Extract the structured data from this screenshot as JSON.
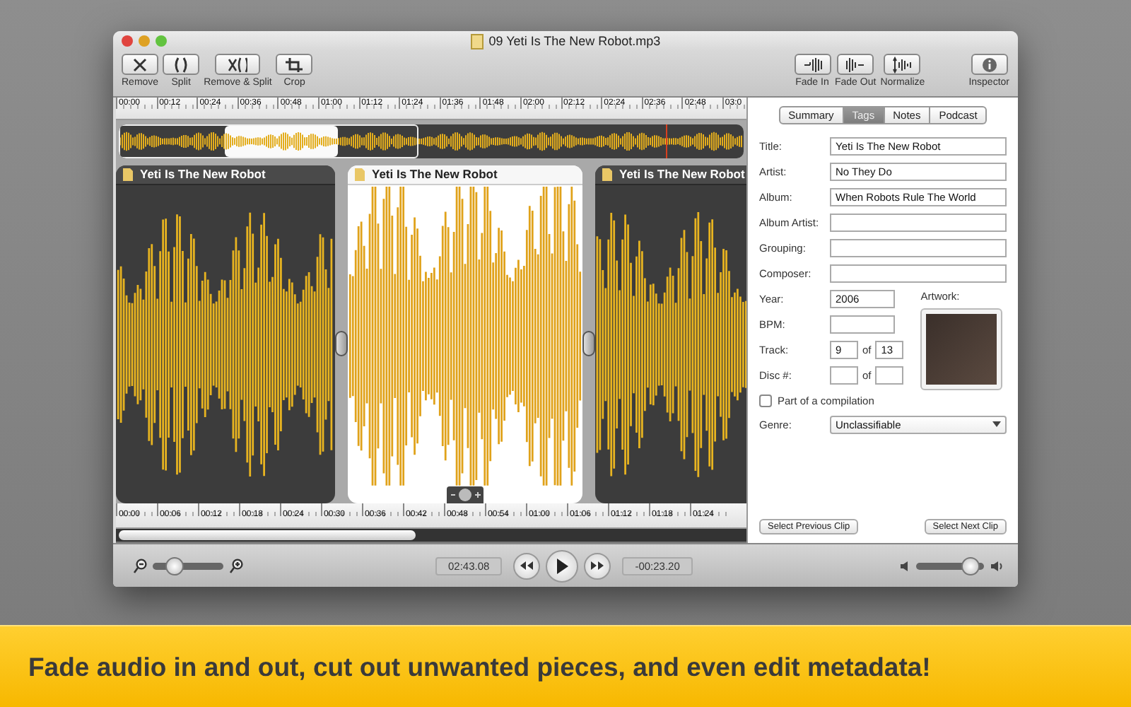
{
  "window": {
    "title": "09 Yeti Is The New Robot.mp3"
  },
  "toolbar": {
    "left": [
      {
        "label": "Remove"
      },
      {
        "label": "Split"
      },
      {
        "label": "Remove & Split"
      },
      {
        "label": "Crop"
      }
    ],
    "right": [
      {
        "label": "Fade In"
      },
      {
        "label": "Fade Out"
      },
      {
        "label": "Normalize"
      },
      {
        "label": "Inspector"
      }
    ]
  },
  "top_ruler": [
    "00:00",
    "00:12",
    "00:24",
    "00:36",
    "00:48",
    "01:00",
    "01:12",
    "01:24",
    "01:36",
    "01:48",
    "02:00",
    "02:12",
    "02:24",
    "02:36",
    "02:48",
    "03:0"
  ],
  "clips": [
    {
      "title": "Yeti Is The New Robot",
      "selected": false
    },
    {
      "title": "Yeti Is The New Robot",
      "selected": true
    },
    {
      "title": "Yeti Is The New Robot",
      "selected": false
    }
  ],
  "bottom_ruler": [
    "00:00",
    "00:06",
    "00:12",
    "00:18",
    "00:24",
    "00:30",
    "00:36",
    "00:42",
    "00:48",
    "00:54",
    "01:00",
    "01:06",
    "01:12",
    "01:18",
    "01:24"
  ],
  "controls": {
    "zoom": {
      "level": 0.3
    },
    "elapsed": "02:43.08",
    "remaining": "-00:23.20",
    "volume": {
      "level": 0.8
    }
  },
  "inspector": {
    "tabs": [
      {
        "label": "Summary",
        "selected": false
      },
      {
        "label": "Tags",
        "selected": true
      },
      {
        "label": "Notes",
        "selected": false
      },
      {
        "label": "Podcast",
        "selected": false
      }
    ],
    "fields": [
      {
        "kind": "wide",
        "label": "Title:",
        "value": "Yeti Is The New Robot"
      },
      {
        "kind": "wide",
        "label": "Artist:",
        "value": "No They Do"
      },
      {
        "kind": "wide",
        "label": "Album:",
        "value": "When Robots Rule The World"
      },
      {
        "kind": "wide",
        "label": "Album Artist:"
      },
      {
        "kind": "wide",
        "label": "Grouping:"
      },
      {
        "kind": "wide",
        "label": "Composer:"
      },
      {
        "kind": "short",
        "label": "Year:",
        "value": "2006"
      },
      {
        "kind": "short",
        "label": "BPM:"
      },
      {
        "kind": "pair",
        "label": "Track:",
        "value": "9",
        "of": "of",
        "total": "13"
      },
      {
        "kind": "pair",
        "label": "Disc #:",
        "of": "of"
      }
    ],
    "artwork_label": "Artwork:",
    "compilation": {
      "label": "Part of a compilation",
      "checked": false
    },
    "genre": {
      "label": "Genre:",
      "value": "Unclassifiable"
    },
    "buttons": [
      "Select Previous Clip",
      "Select Next Clip"
    ]
  },
  "banner": {
    "caption": "Fade audio in and out, cut out unwanted pieces, and even edit metadata!"
  }
}
